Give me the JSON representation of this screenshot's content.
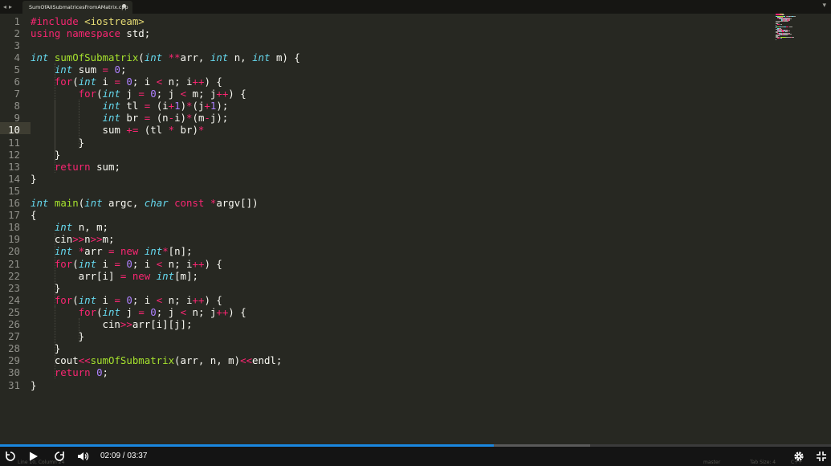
{
  "tab": {
    "title": "SumOfAllSubmatricesFromAMatrix.cpp",
    "nav_back_icon": "chevron-left-icon",
    "nav_forward_icon": "chevron-right-icon",
    "close_icon": "dot-close-icon",
    "menu_icon": "chevron-down-icon"
  },
  "editor": {
    "theme": "monokai",
    "colors": {
      "background": "#272822",
      "keyword": "#f92672",
      "type": "#66d9ef",
      "number": "#ae81ff",
      "function": "#a6e22e",
      "string": "#e6db74",
      "text": "#f8f8f2"
    },
    "active_line": 10,
    "lines": [
      [
        {
          "c": "t-kw",
          "t": "#include "
        },
        {
          "c": "t-str",
          "t": "<iostream>"
        }
      ],
      [
        {
          "c": "t-kw",
          "t": "using"
        },
        {
          "t": " "
        },
        {
          "c": "t-kw",
          "t": "namespace"
        },
        {
          "t": " std;"
        }
      ],
      [],
      [
        {
          "c": "t-ty",
          "t": "int"
        },
        {
          "t": " "
        },
        {
          "c": "t-fn",
          "t": "sumOfSubmatrix"
        },
        {
          "t": "("
        },
        {
          "c": "t-ty",
          "t": "int"
        },
        {
          "t": " "
        },
        {
          "c": "t-kw",
          "t": "**"
        },
        {
          "t": "arr, "
        },
        {
          "c": "t-ty",
          "t": "int"
        },
        {
          "t": " n, "
        },
        {
          "c": "t-ty",
          "t": "int"
        },
        {
          "t": " m) {"
        }
      ],
      [
        {
          "t": "    "
        },
        {
          "c": "t-ty",
          "t": "int"
        },
        {
          "t": " sum "
        },
        {
          "c": "t-kw",
          "t": "="
        },
        {
          "t": " "
        },
        {
          "c": "t-num",
          "t": "0"
        },
        {
          "t": ";"
        }
      ],
      [
        {
          "t": "    "
        },
        {
          "c": "t-kw",
          "t": "for"
        },
        {
          "t": "("
        },
        {
          "c": "t-ty",
          "t": "int"
        },
        {
          "t": " i "
        },
        {
          "c": "t-kw",
          "t": "="
        },
        {
          "t": " "
        },
        {
          "c": "t-num",
          "t": "0"
        },
        {
          "t": "; i "
        },
        {
          "c": "t-kw",
          "t": "<"
        },
        {
          "t": " n; i"
        },
        {
          "c": "t-kw",
          "t": "++"
        },
        {
          "t": ") {"
        }
      ],
      [
        {
          "t": "        "
        },
        {
          "c": "t-kw",
          "t": "for"
        },
        {
          "t": "("
        },
        {
          "c": "t-ty",
          "t": "int"
        },
        {
          "t": " j "
        },
        {
          "c": "t-kw",
          "t": "="
        },
        {
          "t": " "
        },
        {
          "c": "t-num",
          "t": "0"
        },
        {
          "t": "; j "
        },
        {
          "c": "t-kw",
          "t": "<"
        },
        {
          "t": " m; j"
        },
        {
          "c": "t-kw",
          "t": "++"
        },
        {
          "t": ") {"
        }
      ],
      [
        {
          "t": "            "
        },
        {
          "c": "t-ty",
          "t": "int"
        },
        {
          "t": " tl "
        },
        {
          "c": "t-kw",
          "t": "="
        },
        {
          "t": " (i"
        },
        {
          "c": "t-kw",
          "t": "+"
        },
        {
          "c": "t-num",
          "t": "1"
        },
        {
          "t": ")"
        },
        {
          "c": "t-kw",
          "t": "*"
        },
        {
          "t": "(j"
        },
        {
          "c": "t-kw",
          "t": "+"
        },
        {
          "c": "t-num",
          "t": "1"
        },
        {
          "t": ");"
        }
      ],
      [
        {
          "t": "            "
        },
        {
          "c": "t-ty",
          "t": "int"
        },
        {
          "t": " br "
        },
        {
          "c": "t-kw",
          "t": "="
        },
        {
          "t": " (n"
        },
        {
          "c": "t-kw",
          "t": "-"
        },
        {
          "t": "i)"
        },
        {
          "c": "t-kw",
          "t": "*"
        },
        {
          "t": "(m"
        },
        {
          "c": "t-kw",
          "t": "-"
        },
        {
          "t": "j);"
        }
      ],
      [
        {
          "t": "            sum "
        },
        {
          "c": "t-kw",
          "t": "+="
        },
        {
          "t": " (tl "
        },
        {
          "c": "t-kw",
          "t": "*"
        },
        {
          "t": " br)"
        },
        {
          "c": "t-kw",
          "t": "*"
        }
      ],
      [
        {
          "t": "        }"
        }
      ],
      [
        {
          "t": "    }"
        }
      ],
      [
        {
          "t": "    "
        },
        {
          "c": "t-kw",
          "t": "return"
        },
        {
          "t": " sum;"
        }
      ],
      [
        {
          "t": "}"
        }
      ],
      [],
      [
        {
          "c": "t-ty",
          "t": "int"
        },
        {
          "t": " "
        },
        {
          "c": "t-fn",
          "t": "main"
        },
        {
          "t": "("
        },
        {
          "c": "t-ty",
          "t": "int"
        },
        {
          "t": " argc, "
        },
        {
          "c": "t-ty",
          "t": "char"
        },
        {
          "t": " "
        },
        {
          "c": "t-kw",
          "t": "const"
        },
        {
          "t": " "
        },
        {
          "c": "t-kw",
          "t": "*"
        },
        {
          "t": "argv[])"
        }
      ],
      [
        {
          "t": "{"
        }
      ],
      [
        {
          "t": "    "
        },
        {
          "c": "t-ty",
          "t": "int"
        },
        {
          "t": " n, m;"
        }
      ],
      [
        {
          "t": "    cin"
        },
        {
          "c": "t-kw",
          "t": ">>"
        },
        {
          "t": "n"
        },
        {
          "c": "t-kw",
          "t": ">>"
        },
        {
          "t": "m;"
        }
      ],
      [
        {
          "t": "    "
        },
        {
          "c": "t-ty",
          "t": "int"
        },
        {
          "t": " "
        },
        {
          "c": "t-kw",
          "t": "*"
        },
        {
          "t": "arr "
        },
        {
          "c": "t-kw",
          "t": "="
        },
        {
          "t": " "
        },
        {
          "c": "t-kw",
          "t": "new"
        },
        {
          "t": " "
        },
        {
          "c": "t-ty",
          "t": "int"
        },
        {
          "c": "t-kw",
          "t": "*"
        },
        {
          "t": "[n];"
        }
      ],
      [
        {
          "t": "    "
        },
        {
          "c": "t-kw",
          "t": "for"
        },
        {
          "t": "("
        },
        {
          "c": "t-ty",
          "t": "int"
        },
        {
          "t": " i "
        },
        {
          "c": "t-kw",
          "t": "="
        },
        {
          "t": " "
        },
        {
          "c": "t-num",
          "t": "0"
        },
        {
          "t": "; i "
        },
        {
          "c": "t-kw",
          "t": "<"
        },
        {
          "t": " n; i"
        },
        {
          "c": "t-kw",
          "t": "++"
        },
        {
          "t": ") {"
        }
      ],
      [
        {
          "t": "        arr[i] "
        },
        {
          "c": "t-kw",
          "t": "="
        },
        {
          "t": " "
        },
        {
          "c": "t-kw",
          "t": "new"
        },
        {
          "t": " "
        },
        {
          "c": "t-ty",
          "t": "int"
        },
        {
          "t": "[m];"
        }
      ],
      [
        {
          "t": "    }"
        }
      ],
      [
        {
          "t": "    "
        },
        {
          "c": "t-kw",
          "t": "for"
        },
        {
          "t": "("
        },
        {
          "c": "t-ty",
          "t": "int"
        },
        {
          "t": " i "
        },
        {
          "c": "t-kw",
          "t": "="
        },
        {
          "t": " "
        },
        {
          "c": "t-num",
          "t": "0"
        },
        {
          "t": "; i "
        },
        {
          "c": "t-kw",
          "t": "<"
        },
        {
          "t": " n; i"
        },
        {
          "c": "t-kw",
          "t": "++"
        },
        {
          "t": ") {"
        }
      ],
      [
        {
          "t": "        "
        },
        {
          "c": "t-kw",
          "t": "for"
        },
        {
          "t": "("
        },
        {
          "c": "t-ty",
          "t": "int"
        },
        {
          "t": " j "
        },
        {
          "c": "t-kw",
          "t": "="
        },
        {
          "t": " "
        },
        {
          "c": "t-num",
          "t": "0"
        },
        {
          "t": "; j "
        },
        {
          "c": "t-kw",
          "t": "<"
        },
        {
          "t": " n; j"
        },
        {
          "c": "t-kw",
          "t": "++"
        },
        {
          "t": ") {"
        }
      ],
      [
        {
          "t": "            cin"
        },
        {
          "c": "t-kw",
          "t": ">>"
        },
        {
          "t": "arr[i][j];"
        }
      ],
      [
        {
          "t": "        }"
        }
      ],
      [
        {
          "t": "    }"
        }
      ],
      [
        {
          "t": "    cout"
        },
        {
          "c": "t-kw",
          "t": "<<"
        },
        {
          "c": "t-fn",
          "t": "sumOfSubmatrix"
        },
        {
          "t": "(arr, n, m)"
        },
        {
          "c": "t-kw",
          "t": "<<"
        },
        {
          "t": "endl;"
        }
      ],
      [
        {
          "t": "    "
        },
        {
          "c": "t-kw",
          "t": "return"
        },
        {
          "t": " "
        },
        {
          "c": "t-num",
          "t": "0"
        },
        {
          "t": ";"
        }
      ],
      [
        {
          "t": "}"
        }
      ]
    ]
  },
  "status_bar": {
    "position": "Line 10, Column 24",
    "branch": "master",
    "tab_size": "Tab Size: 4",
    "syntax": "C++"
  },
  "player": {
    "current_time": "02:09",
    "duration": "03:37",
    "time_display": "02:09 / 03:37",
    "played_fraction": 0.594,
    "buffered_fraction": 0.71,
    "progress_color": "#1a87e0",
    "icons": {
      "rewind": "replay-icon",
      "play": "play-icon",
      "forward": "forward-icon",
      "volume": "volume-icon",
      "settings": "gear-icon",
      "fullscreen": "fullscreen-exit-icon"
    }
  }
}
